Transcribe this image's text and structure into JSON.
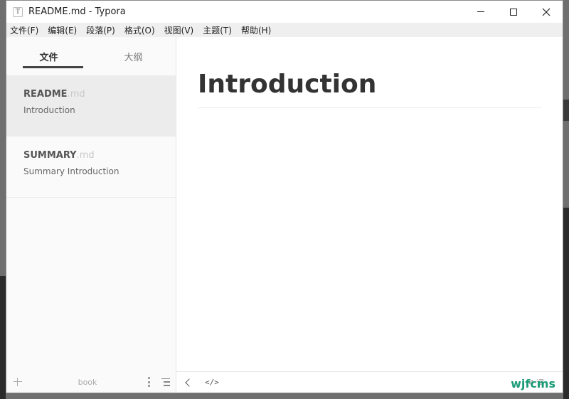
{
  "window": {
    "title": "README.md - Typora",
    "app_icon_letter": "T"
  },
  "menu": [
    {
      "label": "文件(F)"
    },
    {
      "label": "编辑(E)"
    },
    {
      "label": "段落(P)"
    },
    {
      "label": "格式(O)"
    },
    {
      "label": "视图(V)"
    },
    {
      "label": "主题(T)"
    },
    {
      "label": "帮助(H)"
    }
  ],
  "sidebar": {
    "tabs": [
      {
        "label": "文件",
        "active": true
      },
      {
        "label": "大纲",
        "active": false
      }
    ],
    "files": [
      {
        "name": "README",
        "ext": ".md",
        "subtitle": "Introduction",
        "active": true
      },
      {
        "name": "SUMMARY",
        "ext": ".md",
        "subtitle": "Summary Introduction",
        "active": false
      }
    ],
    "footer": {
      "folder_label": "book"
    }
  },
  "editor": {
    "heading": "Introduction",
    "word_count": "4 词"
  },
  "watermark": "wjfcms",
  "colors": {
    "accent": "#444444",
    "watermark": "#1a9a77",
    "active_file_bg": "#ececec"
  }
}
